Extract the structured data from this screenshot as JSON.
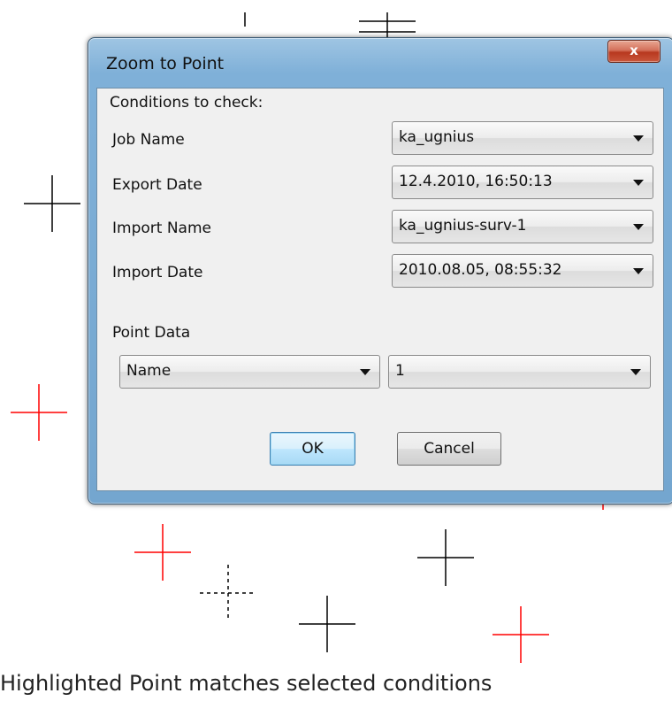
{
  "dialog": {
    "title": "Zoom to Point",
    "close_label": "x",
    "group_label": "Conditions to check:",
    "conditions": [
      {
        "label": "Job Name",
        "value": "ka_ugnius"
      },
      {
        "label": "Export Date",
        "value": "12.4.2010, 16:50:13"
      },
      {
        "label": "Import Name",
        "value": "ka_ugnius-surv-1"
      },
      {
        "label": "Import Date",
        "value": "2010.08.05, 08:55:32"
      }
    ],
    "point_data_label": "Point Data",
    "point_field": "Name",
    "point_value": "1",
    "ok_label": "OK",
    "cancel_label": "Cancel"
  },
  "caption": "Highlighted Point matches selected conditions",
  "colors": {
    "highlight_cross": "#ff0000",
    "normal_cross": "#000000",
    "title_bar": "#7fb0d8",
    "close_button": "#c8563c"
  },
  "icons": [
    "close-icon",
    "dropdown-arrow-icon",
    "point-cross-icon"
  ]
}
